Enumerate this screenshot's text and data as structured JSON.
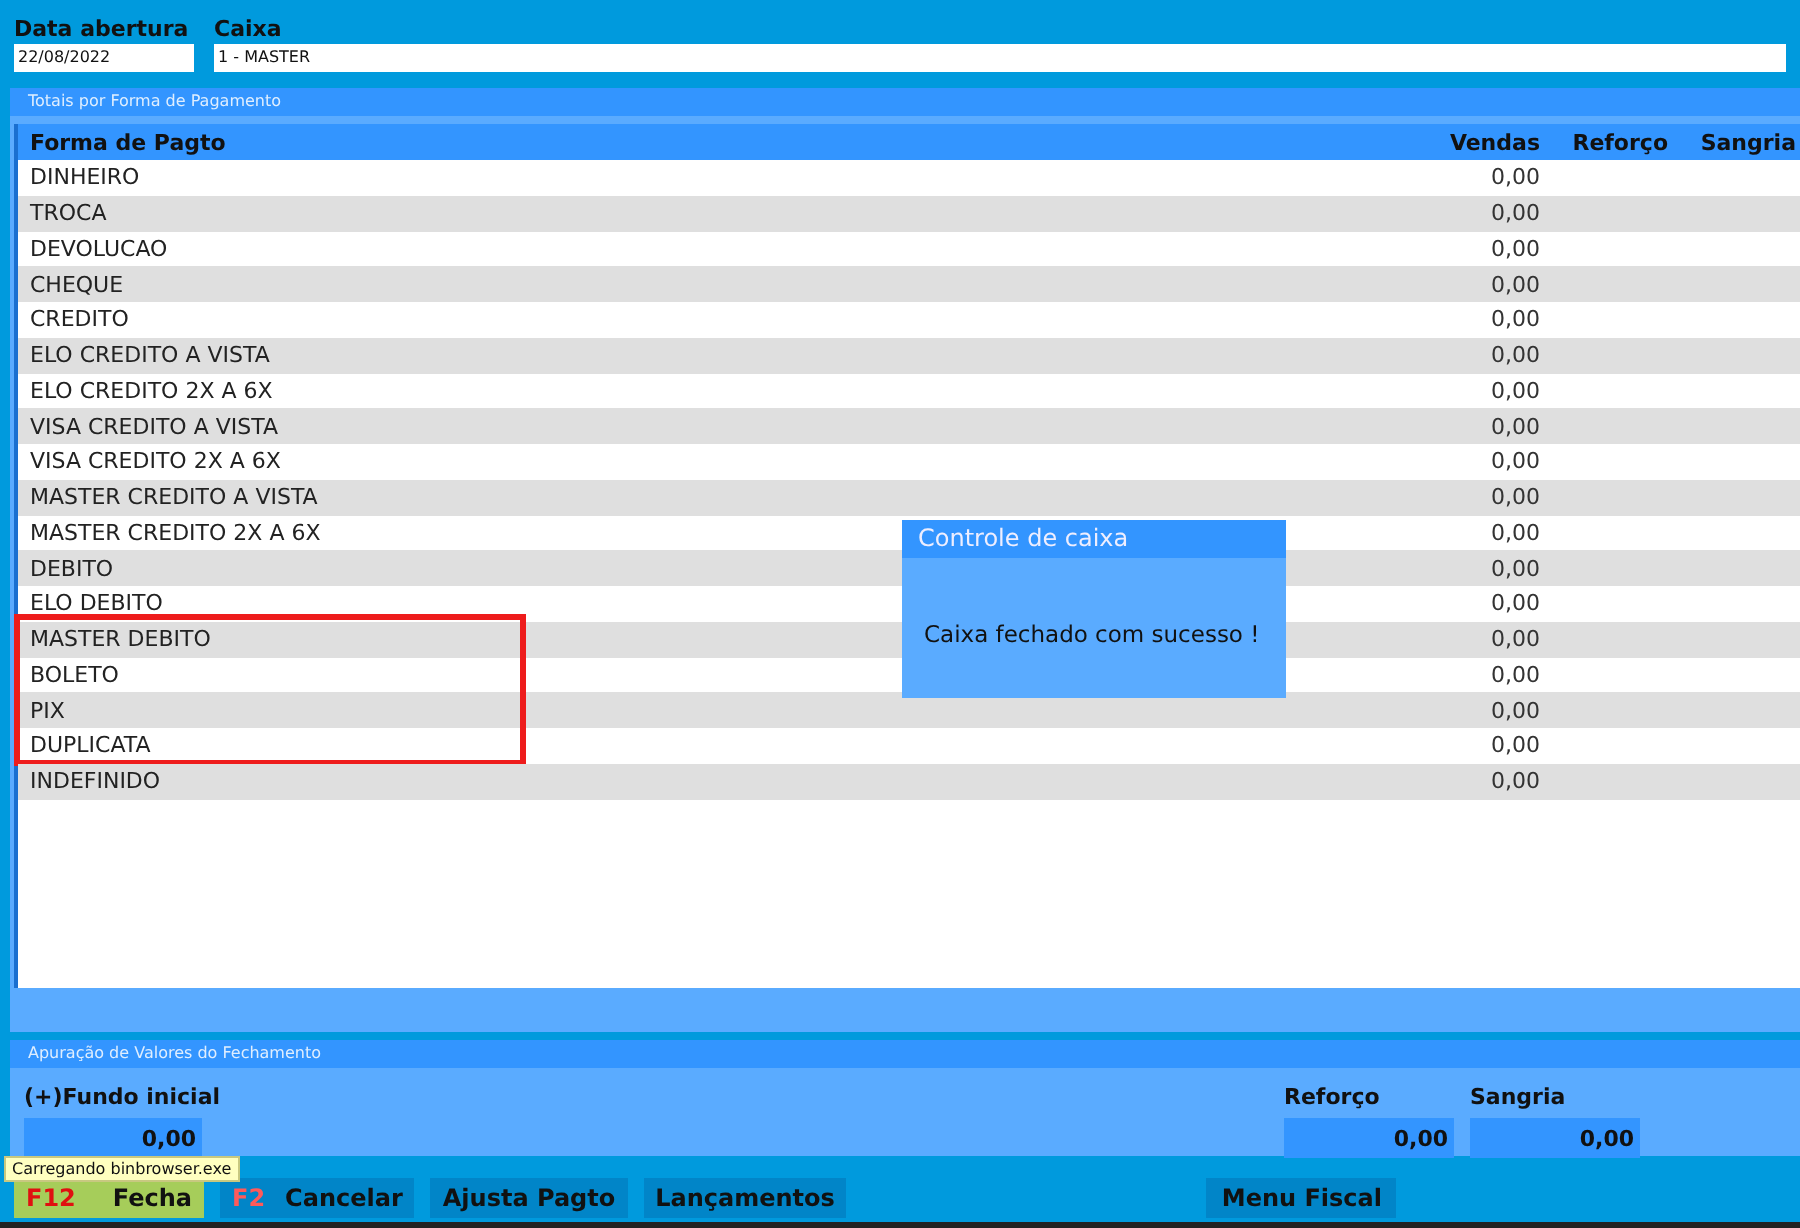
{
  "header": {
    "fields": [
      {
        "label": "Data abertura",
        "value": "22/08/2022"
      },
      {
        "label": "Caixa",
        "value": "1 - MASTER"
      }
    ]
  },
  "totals_panel": {
    "title": "Totais por Forma de Pagamento",
    "table": {
      "columns": [
        "Forma de Pagto",
        "Vendas",
        "Reforço",
        "Sangria"
      ],
      "rows": [
        {
          "name": "DINHEIRO",
          "vendas": "0,00",
          "highlighted": false
        },
        {
          "name": "TROCA",
          "vendas": "0,00",
          "highlighted": false
        },
        {
          "name": "DEVOLUCAO",
          "vendas": "0,00",
          "highlighted": false
        },
        {
          "name": "CHEQUE",
          "vendas": "0,00",
          "highlighted": false
        },
        {
          "name": "CREDITO",
          "vendas": "0,00",
          "highlighted": false
        },
        {
          "name": "ELO CREDITO A VISTA",
          "vendas": "0,00",
          "highlighted": false
        },
        {
          "name": "ELO CREDITO 2X A 6X",
          "vendas": "0,00",
          "highlighted": false
        },
        {
          "name": "VISA CREDITO A VISTA",
          "vendas": "0,00",
          "highlighted": false
        },
        {
          "name": "VISA CREDITO 2X A 6X",
          "vendas": "0,00",
          "highlighted": false
        },
        {
          "name": "MASTER CREDITO A VISTA",
          "vendas": "0,00",
          "highlighted": false
        },
        {
          "name": "MASTER CREDITO 2X A 6X",
          "vendas": "0,00",
          "highlighted": false
        },
        {
          "name": "DEBITO",
          "vendas": "0,00",
          "highlighted": false
        },
        {
          "name": "ELO DEBITO",
          "vendas": "0,00",
          "highlighted": false
        },
        {
          "name": "MASTER DEBITO",
          "vendas": "0,00",
          "highlighted": true
        },
        {
          "name": "BOLETO",
          "vendas": "0,00",
          "highlighted": true
        },
        {
          "name": "PIX",
          "vendas": "0,00",
          "highlighted": true
        },
        {
          "name": "DUPLICATA",
          "vendas": "0,00",
          "highlighted": true
        },
        {
          "name": "INDEFINIDO",
          "vendas": "0,00",
          "highlighted": false
        }
      ]
    }
  },
  "closing_panel": {
    "title": "Apuração de Valores do Fechamento",
    "fundo_inicial": {
      "label": "(+)Fundo inicial",
      "value": "0,00"
    },
    "reforco": {
      "label": "Reforço",
      "value": "0,00"
    },
    "sangria": {
      "label": "Sangria",
      "value": "0,00"
    }
  },
  "tooltip": "Carregando binbrowser.exe",
  "buttons": [
    {
      "key": "F12",
      "label": "Fecha",
      "selected": true
    },
    {
      "key": "F2",
      "label": "Cancelar",
      "selected": false
    },
    {
      "label": "Ajusta Pagto",
      "selected": false
    },
    {
      "label": "Lançamentos",
      "selected": false
    },
    {
      "label": "Menu Fiscal",
      "selected": false
    }
  ],
  "dialog": {
    "title": "Controle de caixa",
    "message": "Caixa fechado com sucesso !"
  }
}
